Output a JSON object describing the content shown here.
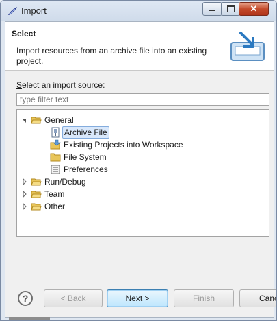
{
  "window": {
    "title": "Import",
    "minimize_glyph": "",
    "maximize_glyph": "",
    "close_glyph": "✕"
  },
  "header": {
    "title": "Select",
    "description": "Import resources from an archive file into an existing project."
  },
  "source": {
    "label_prefix": "S",
    "label_rest": "elect an import source:",
    "filter_placeholder": "type filter text"
  },
  "tree": {
    "general": {
      "label": "General",
      "expanded": true
    },
    "children": [
      {
        "label": "Archive File",
        "icon": "archive-file-icon",
        "selected": true
      },
      {
        "label": "Existing Projects into Workspace",
        "icon": "existing-projects-icon"
      },
      {
        "label": "File System",
        "icon": "folder-icon"
      },
      {
        "label": "Preferences",
        "icon": "preferences-icon"
      }
    ],
    "collapsed": [
      {
        "label": "Run/Debug"
      },
      {
        "label": "Team"
      },
      {
        "label": "Other"
      }
    ]
  },
  "buttons": {
    "back": "< Back",
    "next": "Next >",
    "finish": "Finish",
    "cancel": "Cancel"
  },
  "colors": {
    "selection": "#d9e8fb",
    "folder": "#e8c55a"
  }
}
